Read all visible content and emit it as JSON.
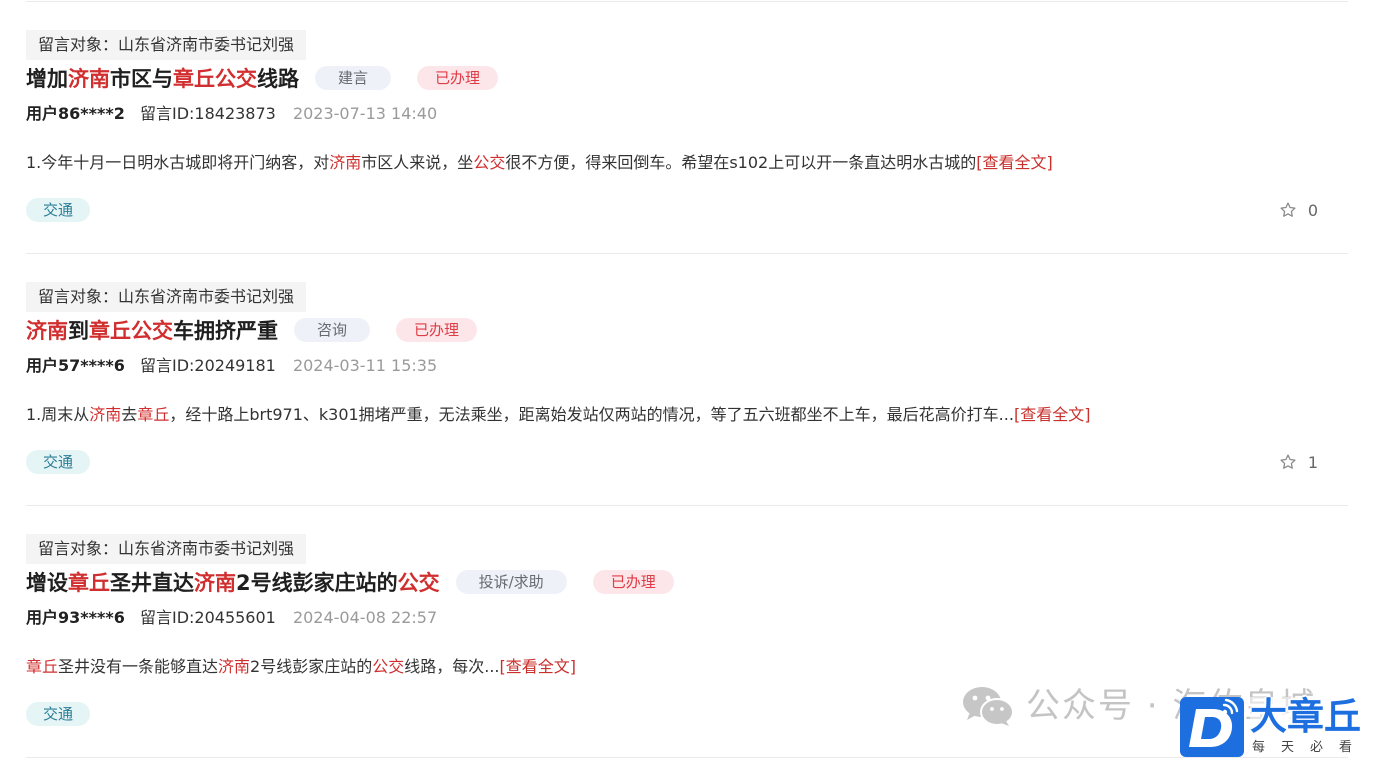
{
  "posts": [
    {
      "target": "留言对象：山东省济南市委书记刘强",
      "title": [
        {
          "t": "增加"
        },
        {
          "t": "济南",
          "hl": true
        },
        {
          "t": "市区与"
        },
        {
          "t": "章丘公交",
          "hl": true
        },
        {
          "t": "线路"
        }
      ],
      "type": "建言",
      "status": "已办理",
      "user": "用户86****2",
      "message_id": "留言ID:18423873",
      "time": "2023-07-13 14:40",
      "body": [
        {
          "t": "1.今年十月一日明水古城即将开门纳客，对"
        },
        {
          "t": "济南",
          "hl": true
        },
        {
          "t": "市区人来说，坐"
        },
        {
          "t": "公交",
          "hl": true
        },
        {
          "t": "很不方便，得来回倒车。希望在s102上可以开一条直达明水古城的"
        }
      ],
      "more": "[查看全文]",
      "category": "交通",
      "favorite_icon": "star-outline-icon",
      "favorites": "0"
    },
    {
      "target": "留言对象：山东省济南市委书记刘强",
      "title": [
        {
          "t": "济南",
          "hl": true
        },
        {
          "t": "到"
        },
        {
          "t": "章丘公交",
          "hl": true
        },
        {
          "t": "车拥挤严重"
        }
      ],
      "type": "咨询",
      "status": "已办理",
      "user": "用户57****6",
      "message_id": "留言ID:20249181",
      "time": "2024-03-11 15:35",
      "body": [
        {
          "t": "1.周末从"
        },
        {
          "t": "济南",
          "hl": true
        },
        {
          "t": "去"
        },
        {
          "t": "章丘",
          "hl": true
        },
        {
          "t": "，经十路上brt971、k301拥堵严重，无法乘坐，距离始发站仅两站的情况，等了五六班都坐不上车，最后花高价打车..."
        }
      ],
      "more": "[查看全文]",
      "category": "交通",
      "favorite_icon": "star-outline-icon",
      "favorites": "1"
    },
    {
      "target": "留言对象：山东省济南市委书记刘强",
      "title": [
        {
          "t": "增设"
        },
        {
          "t": "章丘",
          "hl": true
        },
        {
          "t": "圣井直达"
        },
        {
          "t": "济南",
          "hl": true
        },
        {
          "t": "2号线彭家庄站的"
        },
        {
          "t": "公交",
          "hl": true
        }
      ],
      "type": "投诉/求助",
      "status": "已办理",
      "user": "用户93****6",
      "message_id": "留言ID:20455601",
      "time": "2024-04-08 22:57",
      "body": [
        {
          "t": "章丘",
          "hl": true
        },
        {
          "t": "圣井没有一条能够直达"
        },
        {
          "t": "济南",
          "hl": true
        },
        {
          "t": "2号线彭家庄站的"
        },
        {
          "t": "公交",
          "hl": true
        },
        {
          "t": "线路，每次..."
        }
      ],
      "more": "[查看全文]",
      "category": "交通"
    }
  ],
  "watermark": {
    "icon": "wechat-icon",
    "text": "公众号 · 海佑皇城"
  },
  "logo": {
    "icon": "dazhangqiu-logo-icon",
    "name": "大章丘",
    "slogan": "每天必看"
  },
  "colors": {
    "highlight": "#d12f2f",
    "status_text": "#e03c46",
    "status_bg": "#fde6e9",
    "type_bg": "#eef1f7",
    "category_text": "#2b7d96",
    "category_bg": "#e5f5f6",
    "brand_blue": "#1d6fe0"
  }
}
